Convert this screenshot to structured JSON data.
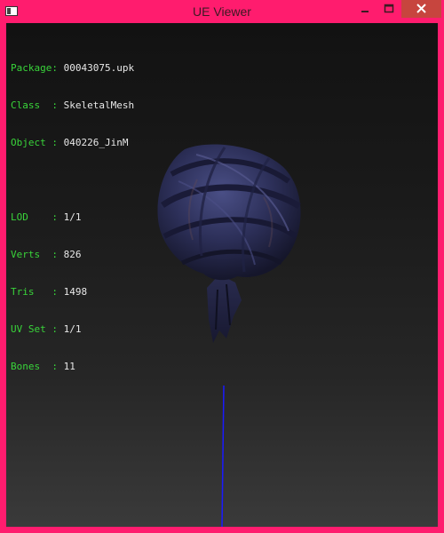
{
  "window": {
    "title": "UE Viewer",
    "controls": [
      "minimize-icon",
      "maximize-icon",
      "close-icon"
    ],
    "accent_color": "#ff1c6e",
    "close_color": "#c7453e"
  },
  "info_panel": {
    "general": [
      {
        "label": "Package: ",
        "value": "00043075.upk"
      },
      {
        "label": "Class  : ",
        "value": "SkeletalMesh"
      },
      {
        "label": "Object : ",
        "value": "040226_JinM"
      }
    ],
    "stats": [
      {
        "label": "LOD    : ",
        "value": "1/1"
      },
      {
        "label": "Verts  : ",
        "value": "826"
      },
      {
        "label": "Tris   : ",
        "value": "1498"
      },
      {
        "label": "UV Set : ",
        "value": "1/1"
      },
      {
        "label": "Bones  : ",
        "value": "11"
      }
    ],
    "label_color": "#39d43a",
    "value_color": "#e8e8e8"
  },
  "scene": {
    "model": "turban-mesh",
    "axis_color": "#1a1aff"
  }
}
